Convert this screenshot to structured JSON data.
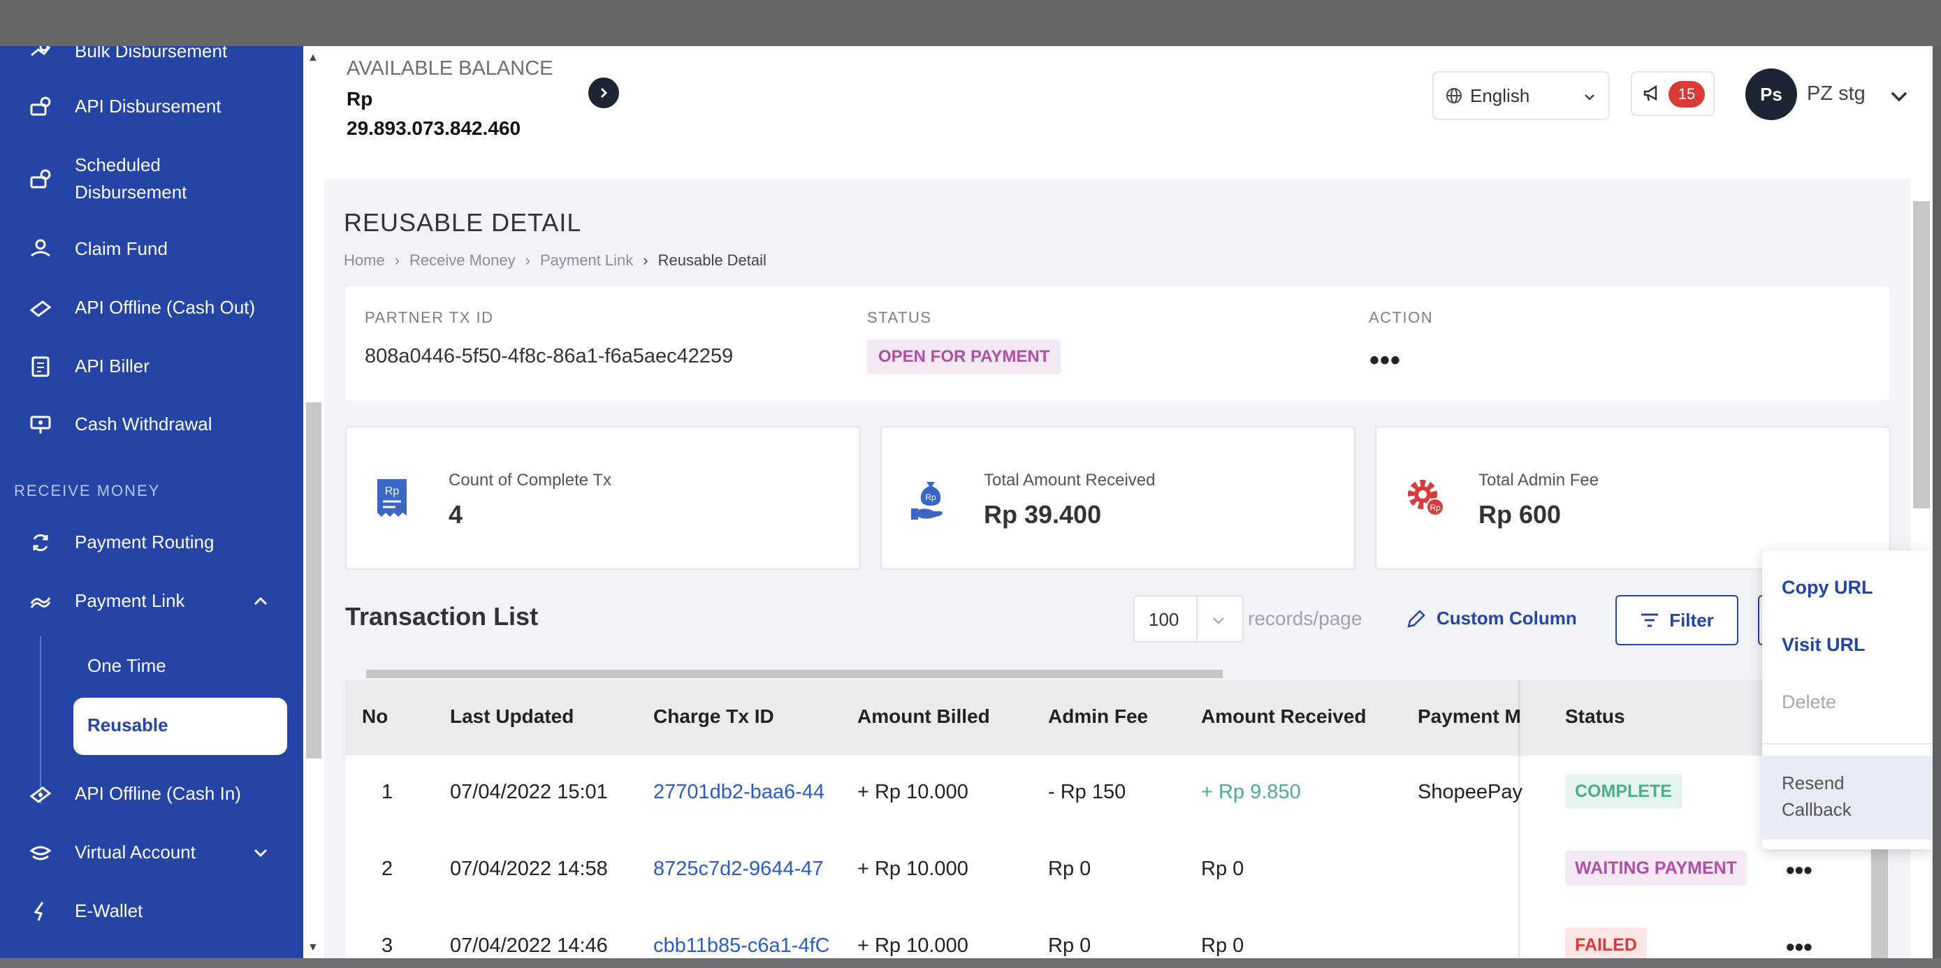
{
  "sidebar": {
    "items": [
      {
        "label": "Bulk Disbursement",
        "icon": "disbursement-icon"
      },
      {
        "label": "API Disbursement",
        "icon": "api-disbursement-icon"
      },
      {
        "label": "Scheduled Disbursement",
        "icon": "scheduled-disbursement-icon"
      },
      {
        "label": "Claim Fund",
        "icon": "claim-fund-icon"
      },
      {
        "label": "API Offline (Cash Out)",
        "icon": "cash-out-icon"
      },
      {
        "label": "API Biller",
        "icon": "biller-icon"
      },
      {
        "label": "Cash Withdrawal",
        "icon": "cash-withdrawal-icon"
      }
    ],
    "section_receive": "RECEIVE MONEY",
    "receive_items": [
      {
        "label": "Payment Routing",
        "icon": "payment-routing-icon"
      },
      {
        "label": "Payment Link",
        "icon": "payment-link-icon"
      }
    ],
    "payment_link_sub": [
      "One Time",
      "Reusable"
    ],
    "more_items": [
      {
        "label": "API Offline (Cash In)",
        "icon": "cash-in-icon"
      },
      {
        "label": "Virtual Account",
        "icon": "virtual-account-icon"
      },
      {
        "label": "E-Wallet",
        "icon": "e-wallet-icon"
      }
    ]
  },
  "header": {
    "balance_title": "AVAILABLE BALANCE",
    "balance_currency": "Rp",
    "balance_value": "29.893.073.842.460",
    "language": "English",
    "notification_count": "15",
    "avatar_initials": "Ps",
    "username": "PZ stg"
  },
  "page": {
    "title": "REUSABLE DETAIL",
    "breadcrumb": [
      "Home",
      "Receive Money",
      "Payment Link",
      "Reusable Detail"
    ]
  },
  "info": {
    "partner_label": "PARTNER TX ID",
    "partner_value": "808a0446-5f50-4f8c-86a1-f6a5aec42259",
    "status_label": "STATUS",
    "status_value": "OPEN FOR PAYMENT",
    "action_label": "ACTION"
  },
  "stats": [
    {
      "label": "Count of Complete Tx",
      "value": "4",
      "icon": "receipt-icon"
    },
    {
      "label": "Total Amount Received",
      "value": "Rp 39.400",
      "icon": "money-bag-hand-icon"
    },
    {
      "label": "Total Admin Fee",
      "value": "Rp 600",
      "icon": "gear-fee-icon"
    }
  ],
  "transactions": {
    "title": "Transaction List",
    "records_per_page": "100",
    "records_label": "records/page",
    "custom_column_label": "Custom Column",
    "filter_label": "Filter",
    "columns": [
      "No",
      "Last Updated",
      "Charge Tx ID",
      "Amount Billed",
      "Admin Fee",
      "Amount Received",
      "Payment M",
      "Status"
    ],
    "rows": [
      {
        "no": "1",
        "updated": "07/04/2022 15:01",
        "charge_id": "27701db2-baa6-44",
        "billed": "+ Rp 10.000",
        "fee": "- Rp 150",
        "received": "+ Rp 9.850",
        "method": "ShopeePay",
        "status": "COMPLETE"
      },
      {
        "no": "2",
        "updated": "07/04/2022 14:58",
        "charge_id": "8725c7d2-9644-47",
        "billed": "+ Rp 10.000",
        "fee": "Rp 0",
        "received": "Rp 0",
        "method": "",
        "status": "WAITING PAYMENT"
      },
      {
        "no": "3",
        "updated": "07/04/2022 14:46",
        "charge_id": "cbb11b85-c6a1-4fC",
        "billed": "+ Rp 10.000",
        "fee": "Rp 0",
        "received": "Rp 0",
        "method": "",
        "status": "FAILED"
      }
    ]
  },
  "action_menu": {
    "copy_url": "Copy URL",
    "visit_url": "Visit URL",
    "delete": "Delete",
    "resend_line1": "Resend",
    "resend_line2": "Callback"
  },
  "colors": {
    "sidebar": "#2445a6",
    "complete": "#4aae8c",
    "waiting": "#b04ea8",
    "failed": "#d93a3a"
  }
}
